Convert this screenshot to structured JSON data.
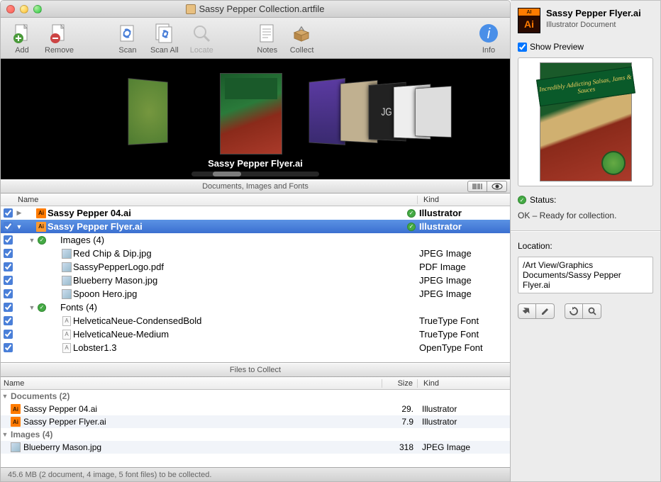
{
  "window": {
    "title": "Sassy Pepper Collection.artfile"
  },
  "toolbar": {
    "add": "Add",
    "remove": "Remove",
    "scan": "Scan",
    "scan_all": "Scan All",
    "locate": "Locate",
    "notes": "Notes",
    "collect": "Collect",
    "info": "Info"
  },
  "coverflow": {
    "caption": "Sassy Pepper Flyer.ai"
  },
  "mid_header": {
    "title": "Documents, Images and Fonts"
  },
  "columns": {
    "name": "Name",
    "kind": "Kind",
    "size": "Size"
  },
  "tree": {
    "rows": [
      {
        "check": true,
        "indent": 0,
        "disc": "▶",
        "status": "",
        "icon": "ai",
        "name": "Sassy Pepper 04.ai",
        "kind": "Illustrator",
        "bold": true,
        "kstatus": true,
        "selected": false
      },
      {
        "check": true,
        "indent": 0,
        "disc": "▼",
        "status": "",
        "icon": "ai",
        "name": "Sassy Pepper Flyer.ai",
        "kind": "Illustrator",
        "bold": true,
        "kstatus": true,
        "selected": true
      },
      {
        "check": true,
        "indent": 1,
        "disc": "▼",
        "status": "ok",
        "icon": "",
        "name": "Images (4)",
        "kind": "",
        "bold": false,
        "kstatus": false,
        "selected": false
      },
      {
        "check": true,
        "indent": 2,
        "disc": "",
        "status": "",
        "icon": "img",
        "name": "Red Chip & Dip.jpg",
        "kind": "JPEG Image",
        "bold": false,
        "kstatus": false,
        "selected": false
      },
      {
        "check": true,
        "indent": 2,
        "disc": "",
        "status": "",
        "icon": "img",
        "name": "SassyPepperLogo.pdf",
        "kind": "PDF Image",
        "bold": false,
        "kstatus": false,
        "selected": false
      },
      {
        "check": true,
        "indent": 2,
        "disc": "",
        "status": "",
        "icon": "img",
        "name": "Blueberry Mason.jpg",
        "kind": "JPEG Image",
        "bold": false,
        "kstatus": false,
        "selected": false
      },
      {
        "check": true,
        "indent": 2,
        "disc": "",
        "status": "",
        "icon": "img",
        "name": "Spoon Hero.jpg",
        "kind": "JPEG Image",
        "bold": false,
        "kstatus": false,
        "selected": false
      },
      {
        "check": true,
        "indent": 1,
        "disc": "▼",
        "status": "ok",
        "icon": "",
        "name": "Fonts (4)",
        "kind": "",
        "bold": false,
        "kstatus": false,
        "selected": false
      },
      {
        "check": true,
        "indent": 2,
        "disc": "",
        "status": "",
        "icon": "font",
        "name": "HelveticaNeue-CondensedBold",
        "kind": "TrueType Font",
        "bold": false,
        "kstatus": false,
        "selected": false
      },
      {
        "check": true,
        "indent": 2,
        "disc": "",
        "status": "",
        "icon": "font",
        "name": "HelveticaNeue-Medium",
        "kind": "TrueType Font",
        "bold": false,
        "kstatus": false,
        "selected": false
      },
      {
        "check": true,
        "indent": 2,
        "disc": "",
        "status": "",
        "icon": "font",
        "name": "Lobster1.3",
        "kind": "OpenType Font",
        "bold": false,
        "kstatus": false,
        "selected": false
      }
    ]
  },
  "collect_header": {
    "title": "Files to Collect"
  },
  "collect": {
    "groups": [
      {
        "label": "Documents (2)",
        "items": [
          {
            "icon": "ai",
            "name": "Sassy Pepper 04.ai",
            "size": "29.",
            "kind": "Illustrator",
            "alt": false
          },
          {
            "icon": "ai",
            "name": "Sassy Pepper Flyer.ai",
            "size": "7.9",
            "kind": "Illustrator",
            "alt": true
          }
        ]
      },
      {
        "label": "Images (4)",
        "items": [
          {
            "icon": "img",
            "name": "Blueberry Mason.jpg",
            "size": "318",
            "kind": "JPEG Image",
            "alt": true
          }
        ]
      }
    ]
  },
  "statusbar": {
    "text": "45.6 MB (2 document, 4 image, 5 font files) to be collected."
  },
  "side": {
    "title": "Sassy Pepper Flyer.ai",
    "subtitle": "Illustrator Document",
    "show_preview": "Show Preview",
    "preview_banner": "Incredibly Addicting\nSalsas, Jams & Sauces",
    "status_label": "Status:",
    "status_msg": "OK – Ready for collection.",
    "location_label": "Location:",
    "location_path": "/Art View/Graphics Documents/Sassy Pepper Flyer.ai"
  }
}
